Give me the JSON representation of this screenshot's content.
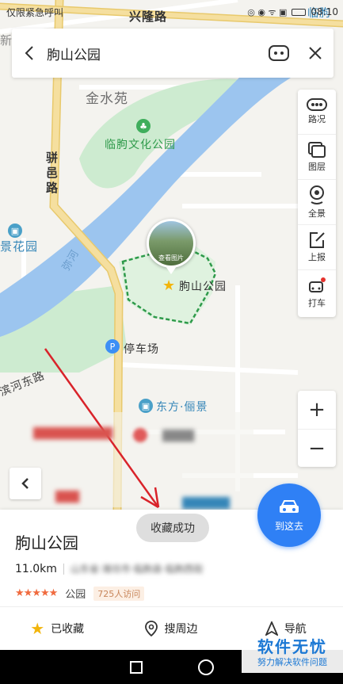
{
  "status_bar": {
    "left_text": "仅限紧急呼叫",
    "time": "08:10"
  },
  "search": {
    "title": "朐山公园"
  },
  "map_labels": {
    "xinglong_road": "兴隆路",
    "xin": "新",
    "jinshuiyuan": "金水苑",
    "culture_park": "临朐文化公园",
    "yiyi_road": "骈邑路",
    "jinghuayuan": "景花园",
    "mihe": "弥河",
    "lin": "临朐",
    "park_name": "朐山公园",
    "parking": "停车场",
    "binhe_east_road": "滨河东路",
    "dongfang_liyjing": "东方·俪景",
    "photo_caption": "查看图片"
  },
  "toolbar": [
    {
      "label": "路况",
      "icon": "traffic-icon"
    },
    {
      "label": "图层",
      "icon": "layers-icon"
    },
    {
      "label": "全景",
      "icon": "panorama-icon"
    },
    {
      "label": "上报",
      "icon": "report-icon"
    },
    {
      "label": "打车",
      "icon": "taxi-icon"
    }
  ],
  "zoom": {
    "in": "+",
    "out": "−"
  },
  "go_button": {
    "label": "到这去"
  },
  "toast": "收藏成功",
  "place": {
    "name": "朐山公园",
    "distance": "11.0km",
    "address": "山东省·潍坊市·临朐县·临朐西街",
    "stars": "★★★★★",
    "category": "公园",
    "visits": "725人访问"
  },
  "actions": [
    {
      "label": "已收藏",
      "icon": "star-icon"
    },
    {
      "label": "搜周边",
      "icon": "location-pin-icon"
    },
    {
      "label": "导航",
      "icon": "navigation-icon"
    }
  ],
  "watermark": {
    "main": "软件无忧",
    "sub": "努力解决软件问题"
  },
  "colors": {
    "accent": "#2f80f5",
    "river": "#9cc5ef",
    "park": "#cdebd0",
    "road": "#f3dc9a",
    "arrow": "#d9232a"
  }
}
